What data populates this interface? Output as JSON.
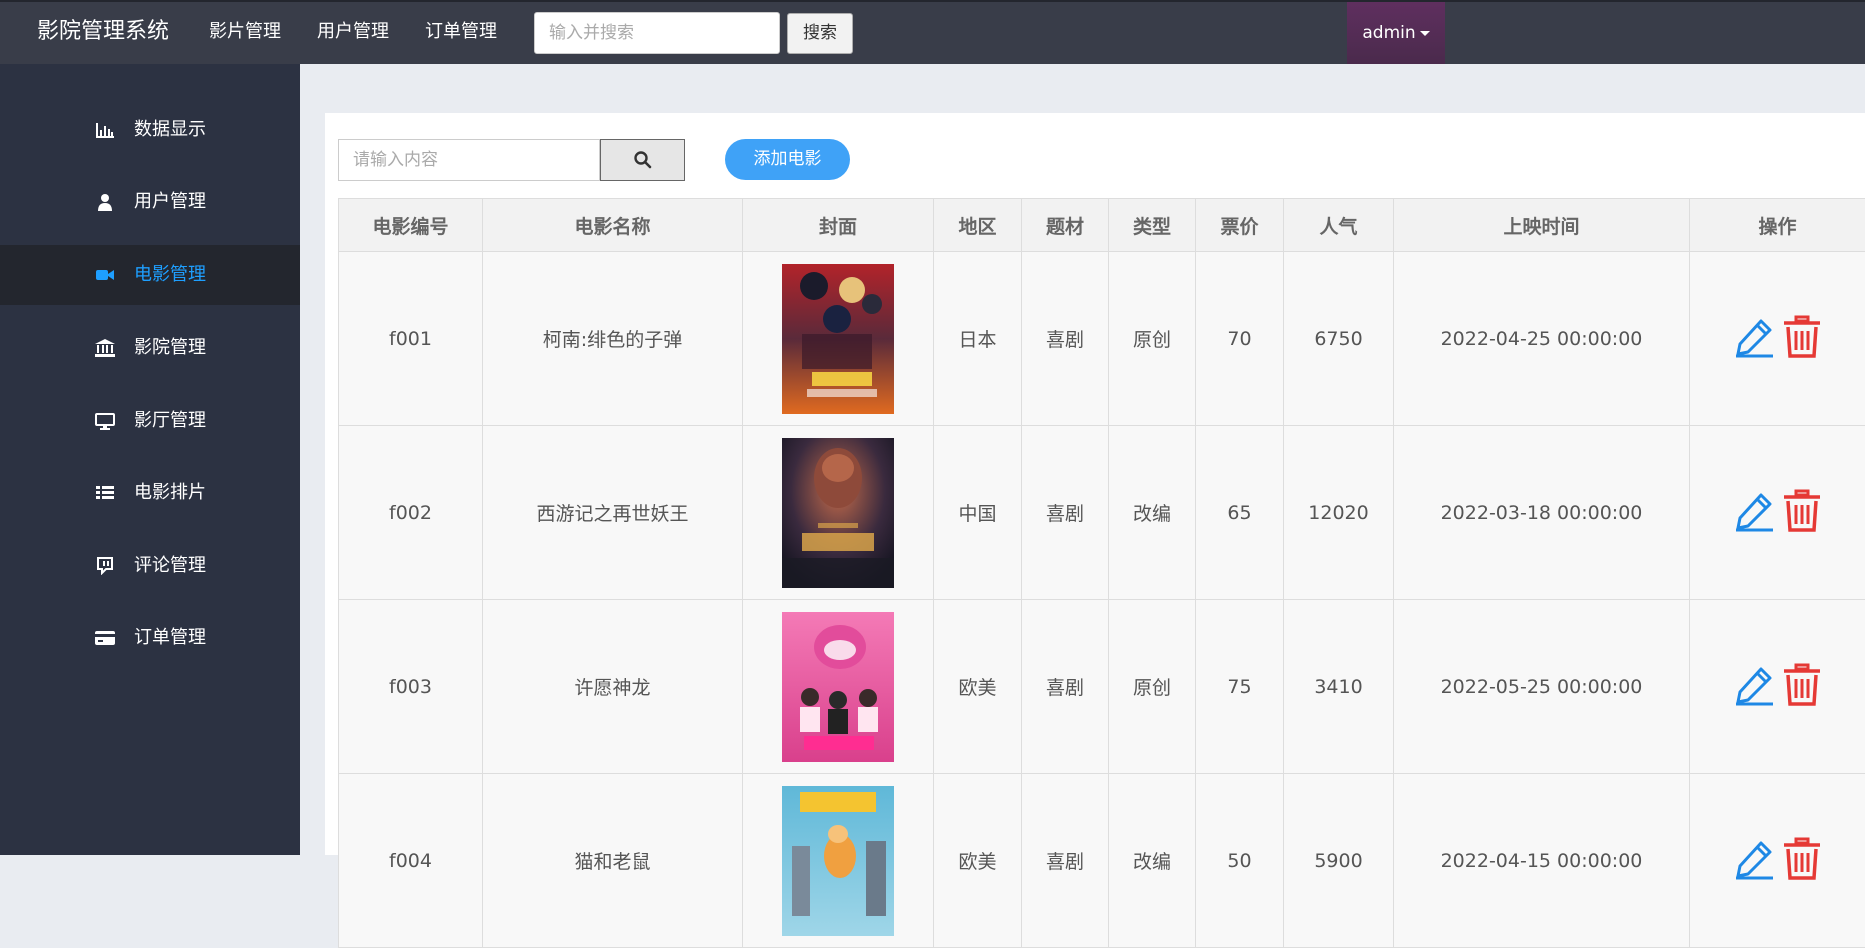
{
  "app": {
    "brand": "影院管理系统",
    "nav": [
      "影片管理",
      "用户管理",
      "订单管理"
    ],
    "search_placeholder": "输入并搜索",
    "search_button": "搜索",
    "user": "admin"
  },
  "sidebar": {
    "items": [
      {
        "label": "数据显示",
        "icon": "bar-chart-icon"
      },
      {
        "label": "用户管理",
        "icon": "user-icon"
      },
      {
        "label": "电影管理",
        "icon": "video-camera-icon",
        "active": true
      },
      {
        "label": "影院管理",
        "icon": "bank-icon"
      },
      {
        "label": "影厅管理",
        "icon": "monitor-icon"
      },
      {
        "label": "电影排片",
        "icon": "list-icon"
      },
      {
        "label": "评论管理",
        "icon": "comment-icon"
      },
      {
        "label": "订单管理",
        "icon": "credit-card-icon"
      }
    ]
  },
  "toolbar": {
    "search_placeholder": "请输入内容",
    "add_label": "添加电影"
  },
  "table": {
    "headers": [
      "电影编号",
      "电影名称",
      "封面",
      "地区",
      "题材",
      "类型",
      "票价",
      "人气",
      "上映时间",
      "操作"
    ],
    "rows": [
      {
        "id": "f001",
        "name": "柯南:绯色的子弹",
        "region": "日本",
        "genre": "喜剧",
        "kind": "原创",
        "price": "70",
        "popularity": "6750",
        "release": "2022-04-25 00:00:00"
      },
      {
        "id": "f002",
        "name": "西游记之再世妖王",
        "region": "中国",
        "genre": "喜剧",
        "kind": "改编",
        "price": "65",
        "popularity": "12020",
        "release": "2022-03-18 00:00:00"
      },
      {
        "id": "f003",
        "name": "许愿神龙",
        "region": "欧美",
        "genre": "喜剧",
        "kind": "原创",
        "price": "75",
        "popularity": "3410",
        "release": "2022-05-25 00:00:00"
      },
      {
        "id": "f004",
        "name": "猫和老鼠",
        "region": "欧美",
        "genre": "喜剧",
        "kind": "改编",
        "price": "50",
        "popularity": "5900",
        "release": "2022-04-15 00:00:00"
      }
    ]
  },
  "colors": {
    "topbar": "#393d49",
    "sidebar": "#2c3242",
    "sidebar_active": "#23262e",
    "accent": "#1e9fff",
    "add_button": "#3fa2f7",
    "admin_bg": "#5f2f5f",
    "edit_icon": "#1e88e5",
    "delete_icon": "#e53935"
  }
}
